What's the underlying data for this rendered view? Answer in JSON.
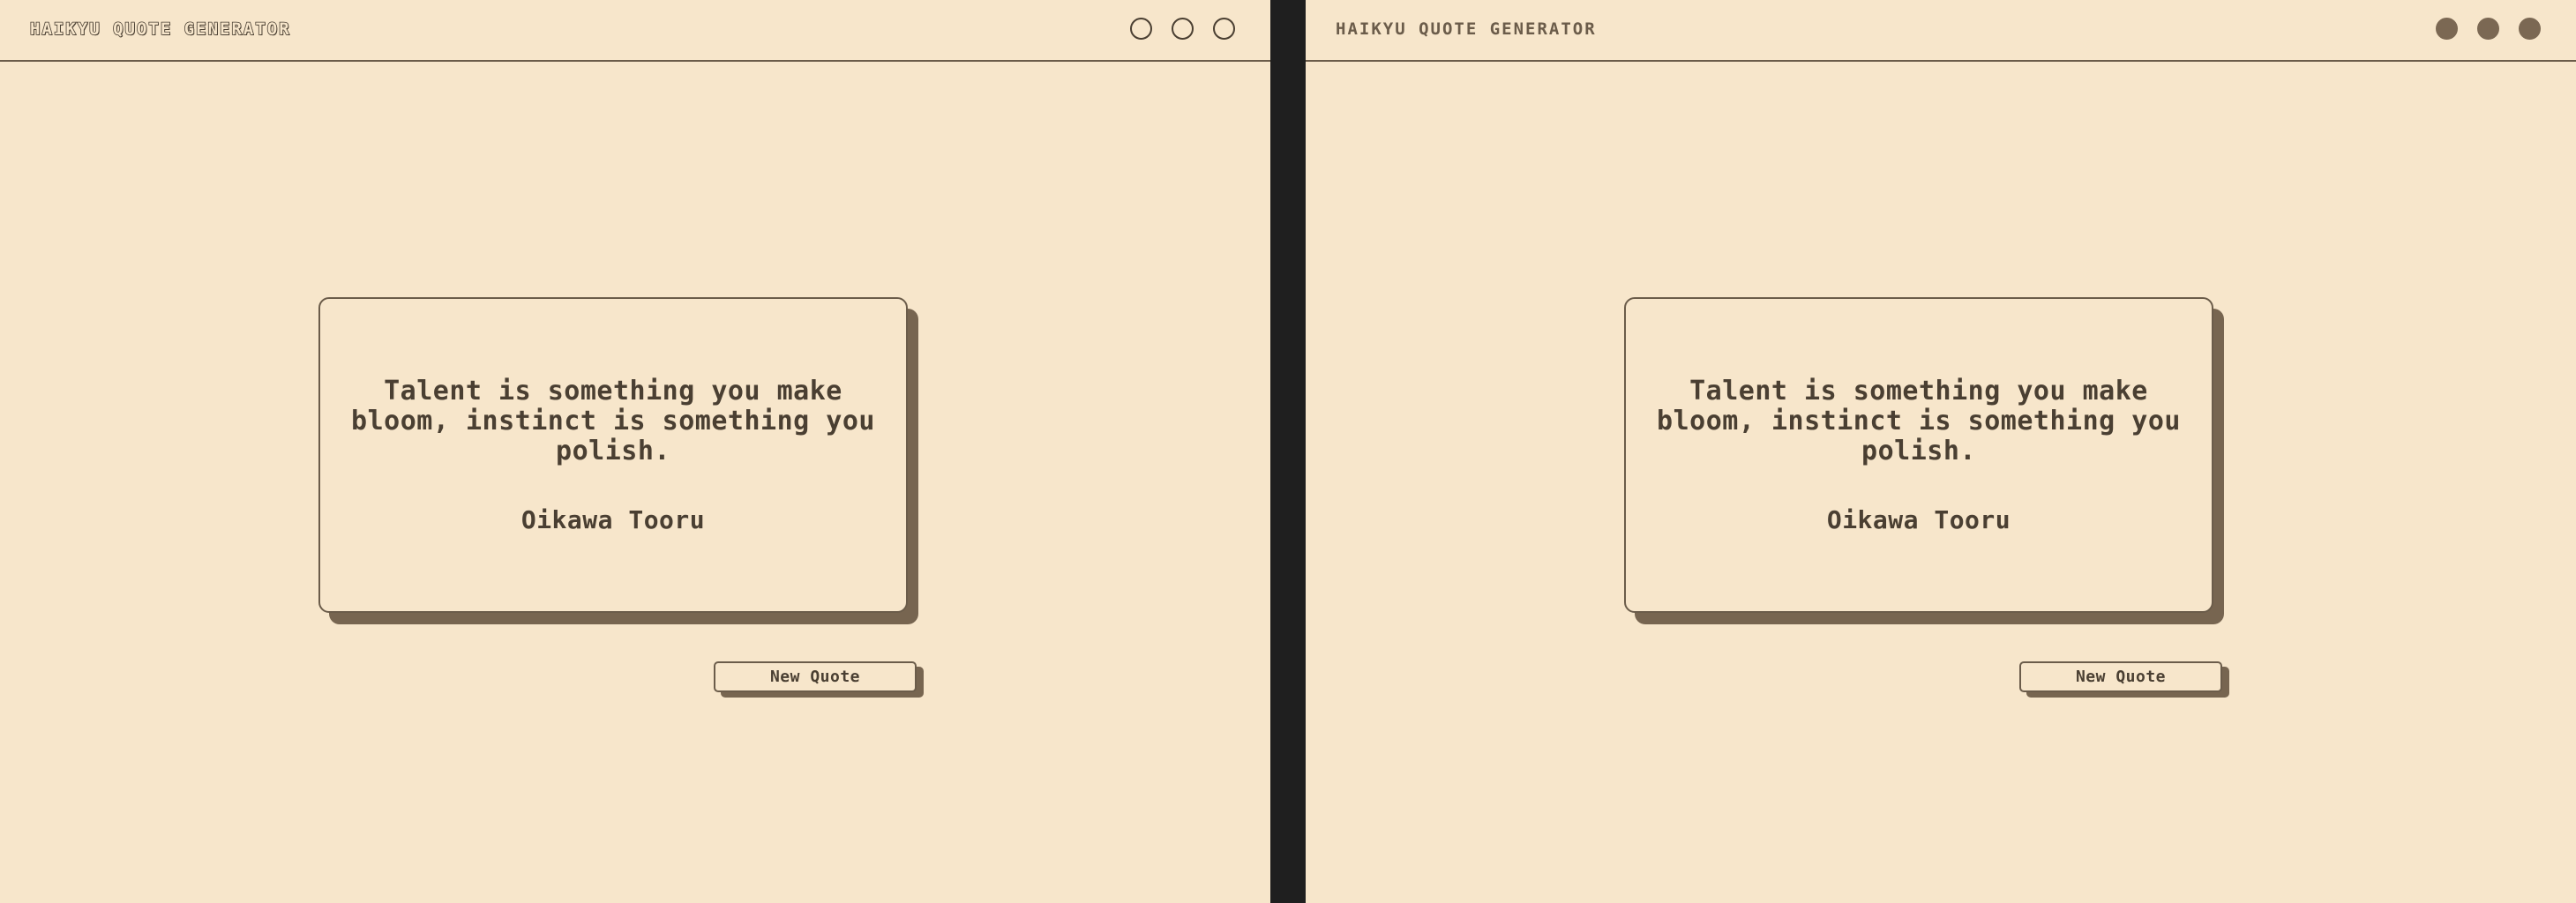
{
  "left_panel": {
    "app_title": "HAIKYU QUOTE GENERATOR",
    "window_controls": [
      "minimize",
      "maximize",
      "close"
    ],
    "quote_text": "Talent is something you make bloom, instinct is something you polish.",
    "quote_author": "Oikawa Tooru",
    "button_label": "New Quote"
  },
  "right_panel": {
    "app_title": "HAIKYU QUOTE GENERATOR",
    "window_controls": [
      "minimize",
      "maximize",
      "close"
    ],
    "quote_text": "Talent is something you make bloom, instinct is something you polish.",
    "quote_author": "Oikawa Tooru",
    "button_label": "New Quote"
  },
  "colors": {
    "background": "#f7e6cb",
    "text": "#4a3f32",
    "shadow": "#776550",
    "divider": "#1f1f1f"
  }
}
